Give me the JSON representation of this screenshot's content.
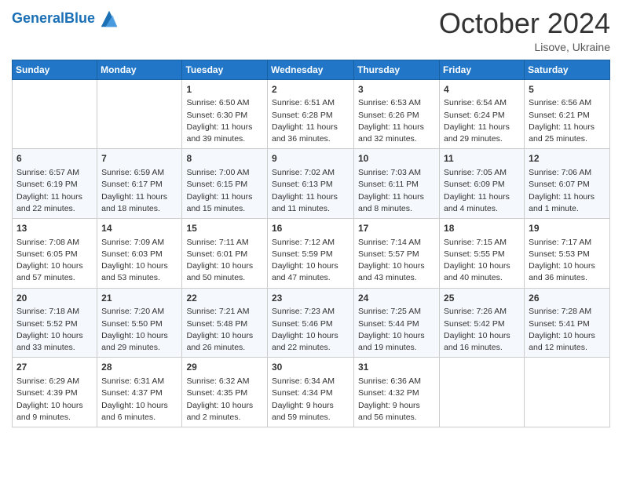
{
  "header": {
    "logo_general": "General",
    "logo_blue": "Blue",
    "month": "October 2024",
    "location": "Lisove, Ukraine"
  },
  "days_of_week": [
    "Sunday",
    "Monday",
    "Tuesday",
    "Wednesday",
    "Thursday",
    "Friday",
    "Saturday"
  ],
  "weeks": [
    [
      {
        "day": "",
        "info": ""
      },
      {
        "day": "",
        "info": ""
      },
      {
        "day": "1",
        "info": "Sunrise: 6:50 AM\nSunset: 6:30 PM\nDaylight: 11 hours and 39 minutes."
      },
      {
        "day": "2",
        "info": "Sunrise: 6:51 AM\nSunset: 6:28 PM\nDaylight: 11 hours and 36 minutes."
      },
      {
        "day": "3",
        "info": "Sunrise: 6:53 AM\nSunset: 6:26 PM\nDaylight: 11 hours and 32 minutes."
      },
      {
        "day": "4",
        "info": "Sunrise: 6:54 AM\nSunset: 6:24 PM\nDaylight: 11 hours and 29 minutes."
      },
      {
        "day": "5",
        "info": "Sunrise: 6:56 AM\nSunset: 6:21 PM\nDaylight: 11 hours and 25 minutes."
      }
    ],
    [
      {
        "day": "6",
        "info": "Sunrise: 6:57 AM\nSunset: 6:19 PM\nDaylight: 11 hours and 22 minutes."
      },
      {
        "day": "7",
        "info": "Sunrise: 6:59 AM\nSunset: 6:17 PM\nDaylight: 11 hours and 18 minutes."
      },
      {
        "day": "8",
        "info": "Sunrise: 7:00 AM\nSunset: 6:15 PM\nDaylight: 11 hours and 15 minutes."
      },
      {
        "day": "9",
        "info": "Sunrise: 7:02 AM\nSunset: 6:13 PM\nDaylight: 11 hours and 11 minutes."
      },
      {
        "day": "10",
        "info": "Sunrise: 7:03 AM\nSunset: 6:11 PM\nDaylight: 11 hours and 8 minutes."
      },
      {
        "day": "11",
        "info": "Sunrise: 7:05 AM\nSunset: 6:09 PM\nDaylight: 11 hours and 4 minutes."
      },
      {
        "day": "12",
        "info": "Sunrise: 7:06 AM\nSunset: 6:07 PM\nDaylight: 11 hours and 1 minute."
      }
    ],
    [
      {
        "day": "13",
        "info": "Sunrise: 7:08 AM\nSunset: 6:05 PM\nDaylight: 10 hours and 57 minutes."
      },
      {
        "day": "14",
        "info": "Sunrise: 7:09 AM\nSunset: 6:03 PM\nDaylight: 10 hours and 53 minutes."
      },
      {
        "day": "15",
        "info": "Sunrise: 7:11 AM\nSunset: 6:01 PM\nDaylight: 10 hours and 50 minutes."
      },
      {
        "day": "16",
        "info": "Sunrise: 7:12 AM\nSunset: 5:59 PM\nDaylight: 10 hours and 47 minutes."
      },
      {
        "day": "17",
        "info": "Sunrise: 7:14 AM\nSunset: 5:57 PM\nDaylight: 10 hours and 43 minutes."
      },
      {
        "day": "18",
        "info": "Sunrise: 7:15 AM\nSunset: 5:55 PM\nDaylight: 10 hours and 40 minutes."
      },
      {
        "day": "19",
        "info": "Sunrise: 7:17 AM\nSunset: 5:53 PM\nDaylight: 10 hours and 36 minutes."
      }
    ],
    [
      {
        "day": "20",
        "info": "Sunrise: 7:18 AM\nSunset: 5:52 PM\nDaylight: 10 hours and 33 minutes."
      },
      {
        "day": "21",
        "info": "Sunrise: 7:20 AM\nSunset: 5:50 PM\nDaylight: 10 hours and 29 minutes."
      },
      {
        "day": "22",
        "info": "Sunrise: 7:21 AM\nSunset: 5:48 PM\nDaylight: 10 hours and 26 minutes."
      },
      {
        "day": "23",
        "info": "Sunrise: 7:23 AM\nSunset: 5:46 PM\nDaylight: 10 hours and 22 minutes."
      },
      {
        "day": "24",
        "info": "Sunrise: 7:25 AM\nSunset: 5:44 PM\nDaylight: 10 hours and 19 minutes."
      },
      {
        "day": "25",
        "info": "Sunrise: 7:26 AM\nSunset: 5:42 PM\nDaylight: 10 hours and 16 minutes."
      },
      {
        "day": "26",
        "info": "Sunrise: 7:28 AM\nSunset: 5:41 PM\nDaylight: 10 hours and 12 minutes."
      }
    ],
    [
      {
        "day": "27",
        "info": "Sunrise: 6:29 AM\nSunset: 4:39 PM\nDaylight: 10 hours and 9 minutes."
      },
      {
        "day": "28",
        "info": "Sunrise: 6:31 AM\nSunset: 4:37 PM\nDaylight: 10 hours and 6 minutes."
      },
      {
        "day": "29",
        "info": "Sunrise: 6:32 AM\nSunset: 4:35 PM\nDaylight: 10 hours and 2 minutes."
      },
      {
        "day": "30",
        "info": "Sunrise: 6:34 AM\nSunset: 4:34 PM\nDaylight: 9 hours and 59 minutes."
      },
      {
        "day": "31",
        "info": "Sunrise: 6:36 AM\nSunset: 4:32 PM\nDaylight: 9 hours and 56 minutes."
      },
      {
        "day": "",
        "info": ""
      },
      {
        "day": "",
        "info": ""
      }
    ]
  ]
}
